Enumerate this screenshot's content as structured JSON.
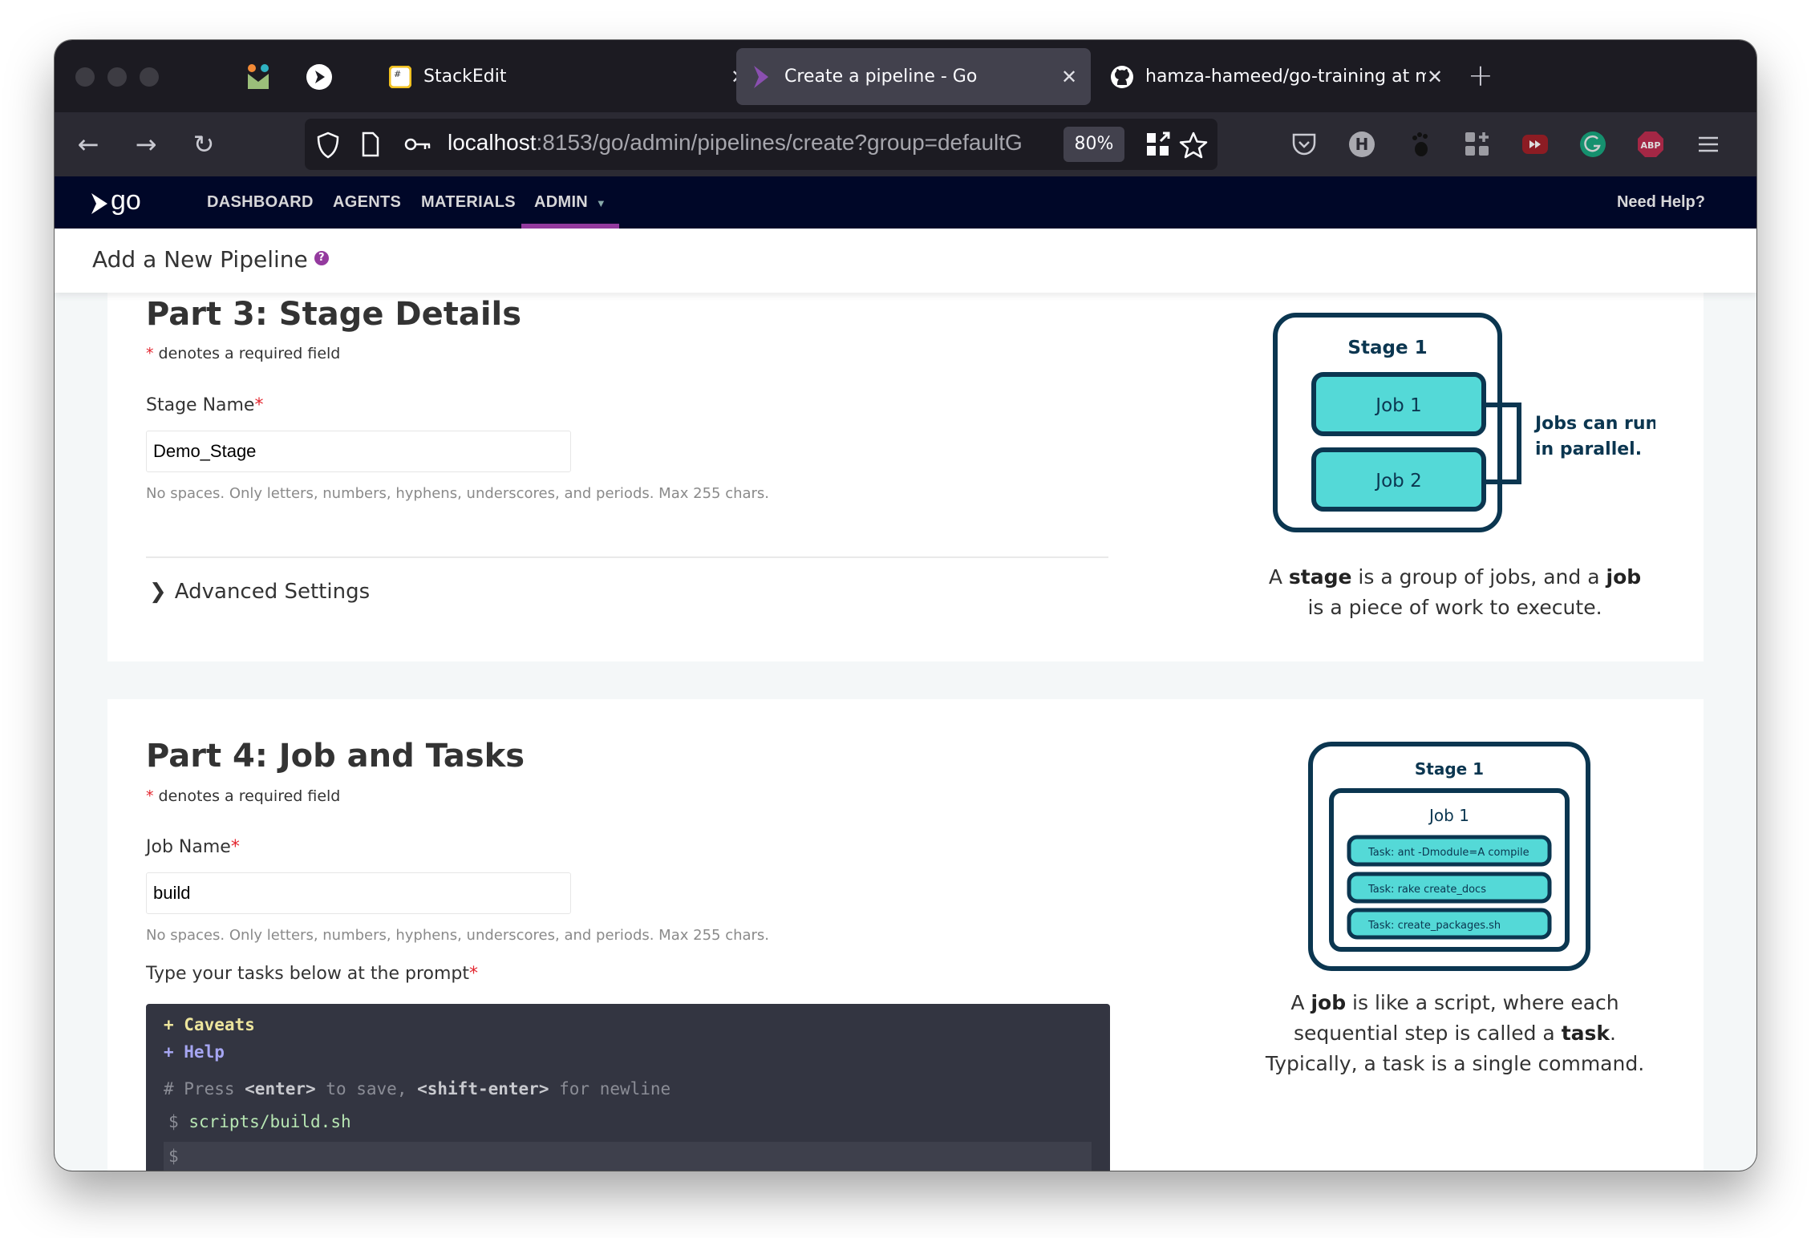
{
  "browser": {
    "tabs": [
      {
        "title": "StackEdit",
        "icon": "stackedit-icon",
        "active": false
      },
      {
        "title": "Create a pipeline - Go",
        "icon": "gocd-icon",
        "active": true
      },
      {
        "title": "hamza-hameed/go-training at m",
        "icon": "github-icon",
        "active": false
      }
    ],
    "pinned_tabs": [
      "metabase-icon",
      "gocd-pinned-icon"
    ],
    "url_host": "localhost",
    "url_rest": ":8153/go/admin/pipelines/create?group=defaultG",
    "zoom_level": "80%",
    "extensions": [
      "pocket-icon",
      "h-icon",
      "gnome-icon",
      "grid-plus-icon",
      "video-speed-icon",
      "grammarly-icon",
      "adblock-plus-icon",
      "hamburger-menu-icon"
    ],
    "extension_labels": {
      "h": "H",
      "g": "G",
      "abp": "ABP"
    }
  },
  "app_nav": {
    "logo": "go",
    "items": [
      "DASHBOARD",
      "AGENTS",
      "MATERIALS",
      "ADMIN"
    ],
    "active": "ADMIN",
    "help": "Need Help?"
  },
  "page": {
    "title": "Add a New Pipeline",
    "help_icon": "?"
  },
  "part3": {
    "title": "Part 3: Stage Details",
    "required_note": "denotes a required field",
    "required_mark": "*",
    "stage_name_label": "Stage Name",
    "stage_name_value": "Demo_Stage",
    "stage_name_hint": "No spaces. Only letters, numbers, hyphens, underscores, and periods. Max 255 chars.",
    "advanced_label": "Advanced Settings",
    "diagram": {
      "stage": "Stage 1",
      "jobs": [
        "Job 1",
        "Job 2"
      ],
      "note_line1": "Jobs can run",
      "note_line2": "in parallel."
    },
    "caption": {
      "a": "A ",
      "stage": "stage",
      "mid": " is a group of jobs, and a ",
      "job": "job",
      "end": " is a piece of work to execute."
    }
  },
  "part4": {
    "title": "Part 4: Job and Tasks",
    "required_note": "denotes a required field",
    "required_mark": "*",
    "job_name_label": "Job Name",
    "job_name_value": "build",
    "job_name_hint": "No spaces. Only letters, numbers, hyphens, underscores, and periods. Max 255 chars.",
    "tasks_label": "Type your tasks below at the prompt",
    "terminal": {
      "caveats": "+ Caveats",
      "help": "+ Help",
      "comment_hash": "# Press ",
      "enter_key": "<enter>",
      "comment_mid": " to save, ",
      "shift_enter_key": "<shift-enter>",
      "comment_end": " for newline",
      "prompt": "$",
      "commands": [
        "scripts/build.sh"
      ],
      "current_input": ""
    },
    "diagram": {
      "stage": "Stage 1",
      "job": "Job 1",
      "tasks": [
        "Task: ant -Dmodule=A compile",
        "Task: rake create_docs",
        "Task: create_packages.sh"
      ]
    },
    "caption": {
      "a": "A ",
      "job": "job",
      "mid": " is like a script, where each sequential step is called a ",
      "task": "task",
      "end": ". Typically, a task is a single command."
    }
  },
  "colors": {
    "nav_bg": "#000728",
    "accent_purple": "#943a9e",
    "diagram_stroke": "#0b3650",
    "diagram_fill": "#54d9d7",
    "required_red": "#e3262f"
  }
}
